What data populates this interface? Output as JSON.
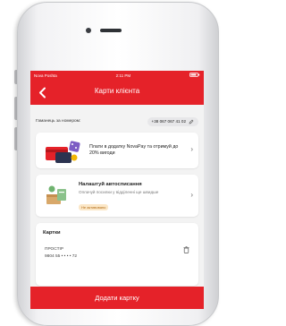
{
  "status_bar": {
    "carrier": "Nova Poshta",
    "time": "2:11 PM"
  },
  "header": {
    "title": "Карти клієнта"
  },
  "wallet": {
    "label": "Гаманець за номером:",
    "phone": "+38 067 067 41 02"
  },
  "promo": {
    "text": "Плати в додатку NovaPay та отримуй до 20% вигоди"
  },
  "autopay": {
    "title": "Налаштуй автосписання",
    "description": "Оплачуй посилки у відділенні ще швидше",
    "badge": "Не активовано"
  },
  "cards": {
    "section_title": "Картки",
    "items": [
      {
        "name": "ПРОСТІР",
        "number": "9804 55 • • • • 72"
      }
    ]
  },
  "actions": {
    "add_card": "Додати картку"
  },
  "colors": {
    "brand": "#e52229",
    "badge_bg": "#fbe7c7",
    "badge_text": "#b36c17"
  }
}
